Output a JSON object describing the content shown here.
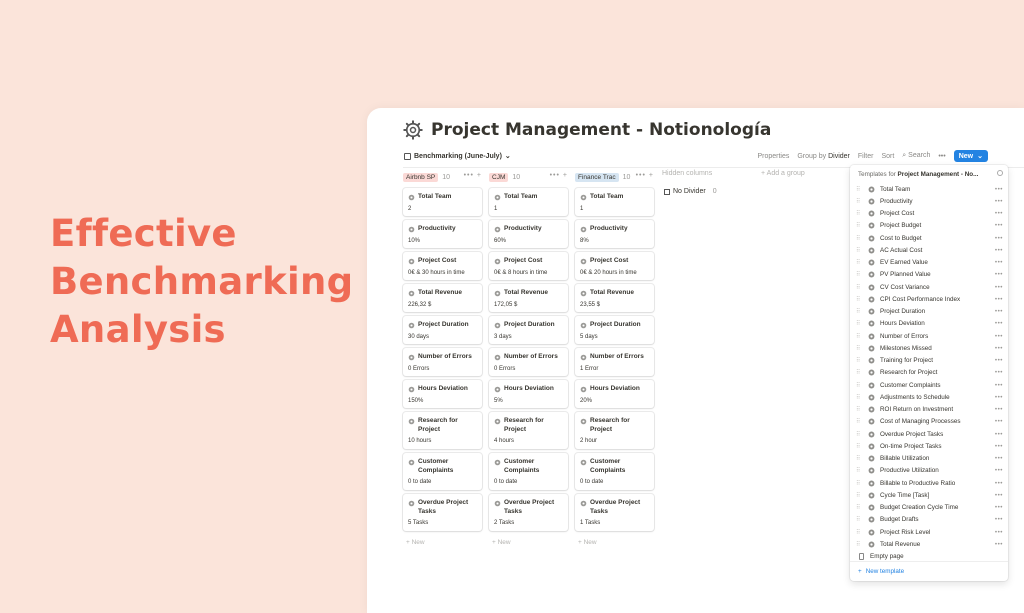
{
  "hero": {
    "lines": [
      "Effective",
      "Benchmarking",
      "Analysis"
    ]
  },
  "page": {
    "title": "Project Management - Notionología",
    "view_label": "Benchmarking (June-July)",
    "toolbar": {
      "properties": "Properties",
      "group_by": "Group by",
      "group_by_value": "Divider",
      "filter": "Filter",
      "sort": "Sort",
      "search": "Search",
      "more": "•••",
      "new": "New"
    }
  },
  "board": {
    "columns": [
      {
        "name": "Airbnb SP",
        "count": "10",
        "color": "#fbd9d6",
        "cards": [
          {
            "title": "Total Team",
            "value": "2"
          },
          {
            "title": "Productivity",
            "value": "10%"
          },
          {
            "title": "Project Cost",
            "value": "0€  & 30 hours in time"
          },
          {
            "title": "Total Revenue",
            "value": "226,32 $"
          },
          {
            "title": "Project Duration",
            "value": "30 days"
          },
          {
            "title": "Number of Errors",
            "value": "0 Errors"
          },
          {
            "title": "Hours Deviation",
            "value": "150%"
          },
          {
            "title": "Research for Project",
            "value": "10 hours"
          },
          {
            "title": "Customer Complaints",
            "value": "0 to date"
          },
          {
            "title": "Overdue Project Tasks",
            "value": "5 Tasks"
          }
        ]
      },
      {
        "name": "CJM",
        "count": "10",
        "color": "#fbd9d6",
        "cards": [
          {
            "title": "Total Team",
            "value": "1"
          },
          {
            "title": "Productivity",
            "value": "60%"
          },
          {
            "title": "Project Cost",
            "value": "0€  & 8 hours in time"
          },
          {
            "title": "Total Revenue",
            "value": "172,05 $"
          },
          {
            "title": "Project Duration",
            "value": "3 days"
          },
          {
            "title": "Number of Errors",
            "value": "0 Errors"
          },
          {
            "title": "Hours Deviation",
            "value": "5%"
          },
          {
            "title": "Research for Project",
            "value": "4 hours"
          },
          {
            "title": "Customer Complaints",
            "value": "0 to date"
          },
          {
            "title": "Overdue Project Tasks",
            "value": "2 Tasks"
          }
        ]
      },
      {
        "name": "Finance Trac",
        "count": "10",
        "color": "#d6e5f2",
        "cards": [
          {
            "title": "Total Team",
            "value": "1"
          },
          {
            "title": "Productivity",
            "value": "8%"
          },
          {
            "title": "Project Cost",
            "value": "0€  & 20 hours in time"
          },
          {
            "title": "Total Revenue",
            "value": "23,55 $"
          },
          {
            "title": "Project Duration",
            "value": "5 days"
          },
          {
            "title": "Number of Errors",
            "value": "1 Error"
          },
          {
            "title": "Hours Deviation",
            "value": "20%"
          },
          {
            "title": "Research for Project",
            "value": "2 hour"
          },
          {
            "title": "Customer Complaints",
            "value": "0 to date"
          },
          {
            "title": "Overdue Project Tasks",
            "value": "1 Tasks"
          }
        ]
      }
    ],
    "add_new": "+ New",
    "column_tools": "••• +",
    "hidden_columns": "Hidden columns",
    "no_divider": "No Divider",
    "no_divider_count": "0",
    "add_group": "+ Add a group"
  },
  "templates_menu": {
    "prefix": "Templates for ",
    "bold": "Project Management - No...",
    "items": [
      "Total Team",
      "Productivity",
      "Project Cost",
      "Project Budget",
      "Cost to Budget",
      "AC Actual Cost",
      "EV Earned Value",
      "PV Planned Value",
      "CV Cost Variance",
      "CPI Cost Performance Index",
      "Project Duration",
      "Hours Deviation",
      "Number of Errors",
      "Milestones Missed",
      "Training for Project",
      "Research for Project",
      "Customer Complaints",
      "Adjustments to Schedule",
      "ROI Return on Investment",
      "Cost of Managing Processes",
      "Overdue Project Tasks",
      "On-time Project Tasks",
      "Billable Utilization",
      "Productive Utilization",
      "Billable to Productive Ratio",
      "Cycle Time [Task]",
      "Budget Creation Cycle Time",
      "Budget Drafts",
      "Project Risk Level",
      "Total Revenue"
    ],
    "empty_page": "Empty page",
    "new_template": "New template",
    "more": "•••"
  }
}
